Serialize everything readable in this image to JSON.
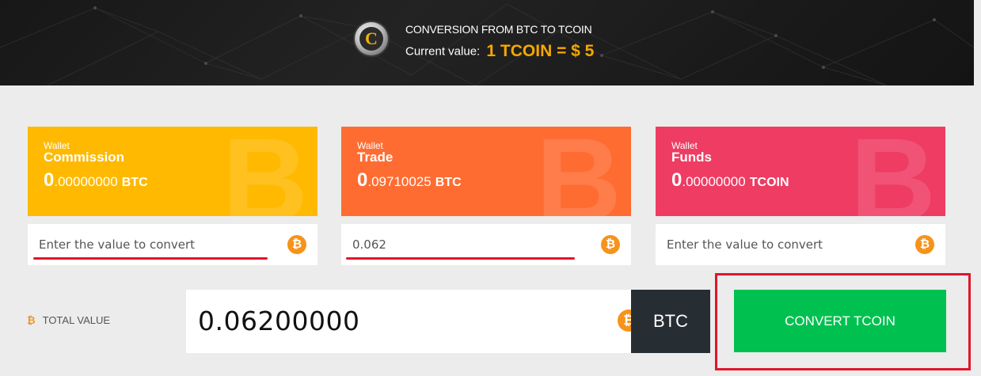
{
  "header": {
    "title": "CONVERSION FROM BTC TO TCOIN",
    "current_label": "Current value:",
    "current_value": "1 TCOIN = $ 5",
    "logo_letter": "C",
    "logo_icon": "tcoin-logo-icon"
  },
  "wallets": [
    {
      "small": "Wallet",
      "name": "Commission",
      "amount_int": "0",
      "amount_dec": ".00000000",
      "currency": "BTC",
      "color": "#ffb900"
    },
    {
      "small": "Wallet",
      "name": "Trade",
      "amount_int": "0",
      "amount_dec": ".09710025",
      "currency": "BTC",
      "color": "#ff6c31"
    },
    {
      "small": "Wallet",
      "name": "Funds",
      "amount_int": "0",
      "amount_dec": ".00000000",
      "currency": "TCOIN",
      "color": "#ee3c63"
    }
  ],
  "inputs": [
    {
      "placeholder": "Enter the value to convert",
      "value": ""
    },
    {
      "placeholder": "Enter the value to convert",
      "value": "0.062"
    },
    {
      "placeholder": "Enter the value to convert",
      "value": ""
    }
  ],
  "total": {
    "label": "TOTAL VALUE",
    "value": "0.06200000",
    "unit": "BTC"
  },
  "convert_button": "CONVERT TCOIN",
  "icons": {
    "btc": "bitcoin-icon",
    "btc_glyph": "₿",
    "btc_watermark": "B"
  },
  "colors": {
    "accent": "#f6a800",
    "convert": "#00c150",
    "highlight": "#e0162b"
  }
}
